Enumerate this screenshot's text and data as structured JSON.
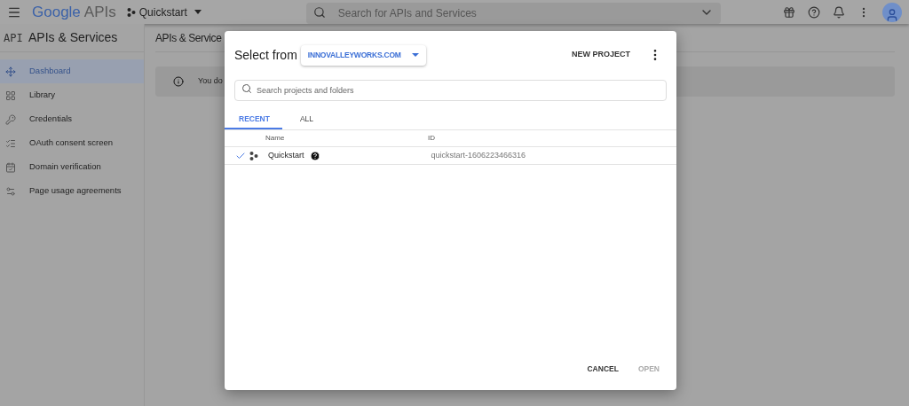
{
  "header": {
    "brand_google": "Google",
    "brand_apis": "APIs",
    "project": "Quickstart",
    "search": {
      "placeholder": "Search for APIs and Services"
    }
  },
  "sidebar": {
    "logo": "API",
    "title": "APIs & Services",
    "items": [
      {
        "label": "Dashboard",
        "selected": true
      },
      {
        "label": "Library",
        "selected": false
      },
      {
        "label": "Credentials",
        "selected": false
      },
      {
        "label": "OAuth consent screen",
        "selected": false
      },
      {
        "label": "Domain verification",
        "selected": false
      },
      {
        "label": "Page usage agreements",
        "selected": false
      }
    ]
  },
  "content": {
    "title": "APIs & Service",
    "banner": "You do"
  },
  "dialog": {
    "title": "Select from",
    "organization": "INNOVALLEYWORKS.COM",
    "new_project": "NEW PROJECT",
    "search": {
      "placeholder": "Search projects and folders"
    },
    "tabs": [
      {
        "label": "RECENT",
        "selected": true
      },
      {
        "label": "ALL",
        "selected": false
      }
    ],
    "columns": [
      "Name",
      "ID"
    ],
    "rows": [
      {
        "name": "Quickstart",
        "id": "quickstart-1606223466316",
        "checked": true
      }
    ],
    "buttons": [
      {
        "label": "CANCEL",
        "disabled": false
      },
      {
        "label": "OPEN",
        "disabled": true
      }
    ]
  }
}
